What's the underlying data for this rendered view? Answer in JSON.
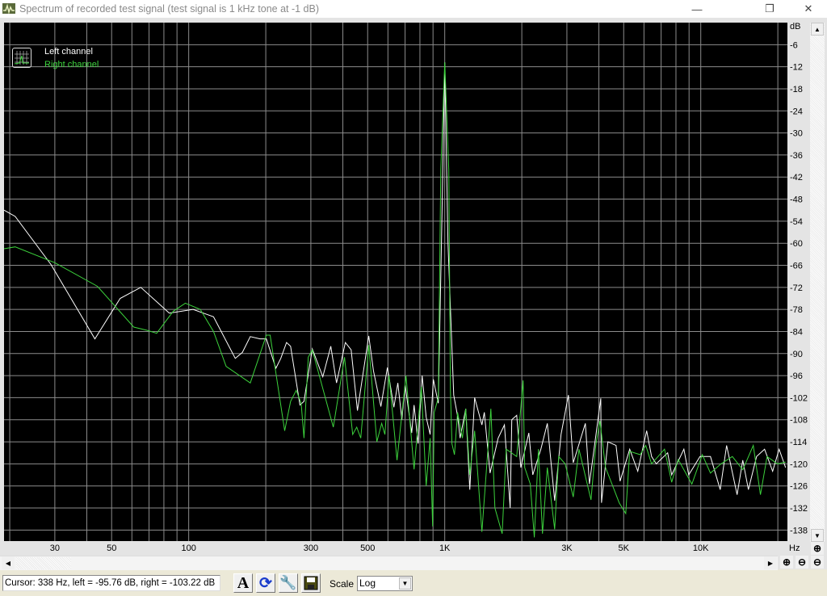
{
  "window": {
    "title": "Spectrum of recorded test signal (test signal is 1 kHz tone at -1 dB)"
  },
  "legend": {
    "left": "Left channel",
    "right": "Right channel"
  },
  "status": {
    "cursor_text": "Cursor:  338 Hz,  left = -95.76 dB,  right = -103.22 dB"
  },
  "toolbar": {
    "scale_label": "Scale",
    "scale_value": "Log"
  },
  "colors": {
    "left": "#ffffff",
    "right": "#3cd23c",
    "grid": "#8c8c8c",
    "background": "#000000"
  },
  "chart_data": {
    "type": "line",
    "title": "Spectrum of recorded test signal (test signal is 1 kHz tone at -1 dB)",
    "xlabel": "Hz",
    "ylabel": "dB",
    "xscale": "log",
    "xlim": [
      19,
      21800
    ],
    "ylim": [
      -141,
      0
    ],
    "grid": true,
    "legend_position": "top-left",
    "x_ticks": [
      {
        "v": 30,
        "label": "30"
      },
      {
        "v": 50,
        "label": "50"
      },
      {
        "v": 100,
        "label": "100"
      },
      {
        "v": 300,
        "label": "300"
      },
      {
        "v": 500,
        "label": "500"
      },
      {
        "v": 1000,
        "label": "1K"
      },
      {
        "v": 3000,
        "label": "3K"
      },
      {
        "v": 5000,
        "label": "5K"
      },
      {
        "v": 10000,
        "label": "10K"
      }
    ],
    "y_ticks": [
      -6,
      -12,
      -18,
      -24,
      -30,
      -36,
      -42,
      -48,
      -54,
      -60,
      -66,
      -72,
      -78,
      -84,
      -90,
      -96,
      -102,
      -108,
      -114,
      -120,
      -126,
      -132,
      -138
    ],
    "series": [
      {
        "name": "Left channel",
        "color": "#ffffff",
        "points": [
          [
            19,
            -51
          ],
          [
            21,
            -52.7
          ],
          [
            29,
            -65.8
          ],
          [
            43,
            -86
          ],
          [
            54,
            -75
          ],
          [
            65,
            -72
          ],
          [
            84,
            -79
          ],
          [
            104,
            -78
          ],
          [
            125,
            -80
          ],
          [
            152,
            -91.3
          ],
          [
            162,
            -89.7
          ],
          [
            174,
            -85.4
          ],
          [
            190,
            -86
          ],
          [
            201,
            -86
          ],
          [
            219,
            -94
          ],
          [
            229,
            -91.3
          ],
          [
            241,
            -87
          ],
          [
            250,
            -88
          ],
          [
            272,
            -104
          ],
          [
            282,
            -103
          ],
          [
            304,
            -88.7
          ],
          [
            334,
            -96.3
          ],
          [
            359,
            -88
          ],
          [
            378,
            -98
          ],
          [
            409,
            -87
          ],
          [
            431,
            -89
          ],
          [
            456,
            -105.5
          ],
          [
            505,
            -85.2
          ],
          [
            527,
            -94.8
          ],
          [
            563,
            -104.4
          ],
          [
            597,
            -93.8
          ],
          [
            633,
            -104.6
          ],
          [
            656,
            -98
          ],
          [
            680,
            -108
          ],
          [
            700,
            -98.5
          ],
          [
            743,
            -111.6
          ],
          [
            759,
            -104
          ],
          [
            787,
            -114.5
          ],
          [
            816,
            -96
          ],
          [
            846,
            -107.3
          ],
          [
            877,
            -112
          ],
          [
            903,
            -97
          ],
          [
            944,
            -103.5
          ],
          [
            971,
            -60
          ],
          [
            1000,
            -10.8
          ],
          [
            1030,
            -60
          ],
          [
            1084,
            -101.3
          ],
          [
            1123,
            -107
          ],
          [
            1148,
            -113
          ],
          [
            1208,
            -105
          ],
          [
            1253,
            -127
          ],
          [
            1309,
            -102
          ],
          [
            1397,
            -109.4
          ],
          [
            1428,
            -106
          ],
          [
            1503,
            -122.5
          ],
          [
            1616,
            -113
          ],
          [
            1711,
            -109.4
          ],
          [
            1801,
            -132
          ],
          [
            1828,
            -108
          ],
          [
            1910,
            -106.8
          ],
          [
            1982,
            -121
          ],
          [
            2130,
            -111.6
          ],
          [
            2208,
            -123
          ],
          [
            2373,
            -116
          ],
          [
            2516,
            -109
          ],
          [
            2687,
            -130
          ],
          [
            2847,
            -112
          ],
          [
            3040,
            -101.3
          ],
          [
            3177,
            -119.7
          ],
          [
            3541,
            -109
          ],
          [
            3673,
            -125.5
          ],
          [
            4068,
            -102.2
          ],
          [
            4095,
            -130.6
          ],
          [
            4339,
            -114
          ],
          [
            4667,
            -115
          ],
          [
            4841,
            -124.7
          ],
          [
            5278,
            -116
          ],
          [
            5675,
            -122
          ],
          [
            6148,
            -111
          ],
          [
            6426,
            -118
          ],
          [
            6702,
            -120
          ],
          [
            7426,
            -117
          ],
          [
            7697,
            -123
          ],
          [
            8590,
            -116
          ],
          [
            8974,
            -123
          ],
          [
            9938,
            -118
          ],
          [
            10914,
            -118
          ],
          [
            11909,
            -127
          ],
          [
            12619,
            -115
          ],
          [
            13870,
            -128.4
          ],
          [
            14593,
            -119
          ],
          [
            15353,
            -127
          ],
          [
            16513,
            -118
          ],
          [
            17755,
            -116
          ],
          [
            19090,
            -122
          ],
          [
            20230,
            -116
          ],
          [
            21440,
            -121
          ]
        ]
      },
      {
        "name": "Right channel",
        "color": "#3cd23c",
        "points": [
          [
            19,
            -61.5
          ],
          [
            21,
            -61
          ],
          [
            30,
            -65.3
          ],
          [
            44,
            -71.7
          ],
          [
            61,
            -82.8
          ],
          [
            69,
            -83.7
          ],
          [
            75,
            -84.5
          ],
          [
            87,
            -78.5
          ],
          [
            97,
            -76.3
          ],
          [
            111,
            -78
          ],
          [
            125,
            -84
          ],
          [
            140,
            -93.5
          ],
          [
            174,
            -98
          ],
          [
            201,
            -85
          ],
          [
            208,
            -85
          ],
          [
            237,
            -111
          ],
          [
            250,
            -103
          ],
          [
            263,
            -100
          ],
          [
            275,
            -103.5
          ],
          [
            282,
            -113
          ],
          [
            293,
            -91
          ],
          [
            304,
            -89
          ],
          [
            367,
            -110
          ],
          [
            406,
            -91
          ],
          [
            437,
            -112
          ],
          [
            453,
            -110
          ],
          [
            470,
            -113
          ],
          [
            505,
            -87.7
          ],
          [
            543,
            -114
          ],
          [
            567,
            -109
          ],
          [
            584,
            -112
          ],
          [
            606,
            -96
          ],
          [
            651,
            -119
          ],
          [
            706,
            -96
          ],
          [
            759,
            -121.5
          ],
          [
            810,
            -99
          ],
          [
            846,
            -126
          ],
          [
            877,
            -113
          ],
          [
            897,
            -137
          ],
          [
            910,
            -106
          ],
          [
            944,
            -102
          ],
          [
            965,
            -40
          ],
          [
            1000,
            -10.8
          ],
          [
            1037,
            -40
          ],
          [
            1052,
            -100
          ],
          [
            1067,
            -114.5
          ],
          [
            1091,
            -117.5
          ],
          [
            1123,
            -106
          ],
          [
            1173,
            -113
          ],
          [
            1208,
            -105
          ],
          [
            1253,
            -123
          ],
          [
            1309,
            -111
          ],
          [
            1397,
            -138.5
          ],
          [
            1514,
            -105
          ],
          [
            1570,
            -132
          ],
          [
            1676,
            -139
          ],
          [
            1738,
            -116
          ],
          [
            1910,
            -118
          ],
          [
            2023,
            -97.3
          ],
          [
            2053,
            -121
          ],
          [
            2159,
            -125.5
          ],
          [
            2238,
            -140
          ],
          [
            2322,
            -116
          ],
          [
            2409,
            -139
          ],
          [
            2516,
            -121
          ],
          [
            2687,
            -137.8
          ],
          [
            2787,
            -118
          ],
          [
            2953,
            -120
          ],
          [
            3177,
            -129
          ],
          [
            3344,
            -116
          ],
          [
            3727,
            -129.8
          ],
          [
            3891,
            -115
          ],
          [
            4036,
            -108.3
          ],
          [
            4246,
            -121
          ],
          [
            4802,
            -130.6
          ],
          [
            5091,
            -133.5
          ],
          [
            5278,
            -116.6
          ],
          [
            5798,
            -117.5
          ],
          [
            6099,
            -115
          ],
          [
            6426,
            -120
          ],
          [
            7215,
            -116
          ],
          [
            7697,
            -125
          ],
          [
            8161,
            -118.8
          ],
          [
            9230,
            -125.5
          ],
          [
            10140,
            -117.5
          ],
          [
            10914,
            -122.5
          ],
          [
            11995,
            -120
          ],
          [
            13280,
            -118
          ],
          [
            14593,
            -121.6
          ],
          [
            16030,
            -115
          ],
          [
            17110,
            -128.4
          ],
          [
            18150,
            -118
          ],
          [
            19950,
            -120
          ],
          [
            21440,
            -119.5
          ]
        ]
      }
    ]
  }
}
